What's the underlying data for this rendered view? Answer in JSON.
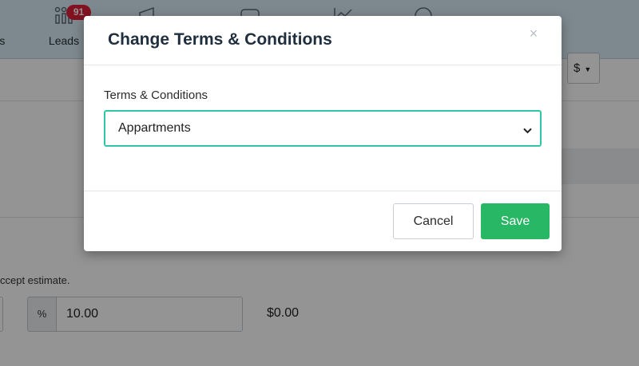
{
  "nav": {
    "items": [
      {
        "label": "Clients",
        "icon": "clients-icon"
      },
      {
        "label": "Leads",
        "icon": "leads-bar-icon",
        "badge": "91"
      },
      {
        "label": "",
        "icon": "megaphone-icon"
      },
      {
        "label": "",
        "icon": "car-icon"
      },
      {
        "label": "",
        "icon": "trend-chart-icon"
      },
      {
        "label": "",
        "icon": "smiley-icon"
      }
    ]
  },
  "page": {
    "currency_value": "$",
    "accept_text": "ccept estimate.",
    "discount_unit": "%",
    "discount_value": "10.00",
    "total_amount": "$0.00"
  },
  "modal": {
    "title": "Change Terms & Conditions",
    "close_label": "×",
    "field_label": "Terms & Conditions",
    "selected_value": "Appartments",
    "cancel_label": "Cancel",
    "save_label": "Save"
  },
  "colors": {
    "accent_border": "#2fc7a6",
    "save_button": "#28b765",
    "badge": "#e0203a",
    "nav_background": "#d7ecf6"
  }
}
